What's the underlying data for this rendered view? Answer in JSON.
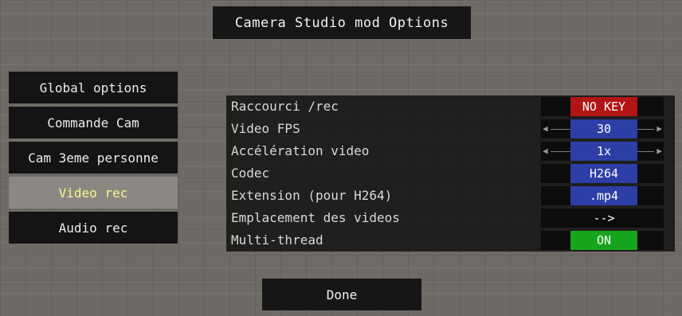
{
  "title": "Camera Studio mod Options",
  "sidebar": {
    "items": [
      {
        "label": "Global options"
      },
      {
        "label": "Commande Cam"
      },
      {
        "label": "Cam 3eme personne"
      },
      {
        "label": "Video rec",
        "active": true
      },
      {
        "label": "Audio rec"
      }
    ]
  },
  "options": [
    {
      "label": "Raccourci  /rec",
      "value": "NO KEY",
      "style": "red"
    },
    {
      "label": "Video FPS",
      "value": "30",
      "style": "blue",
      "slider": true
    },
    {
      "label": "Accélération video",
      "value": "1x",
      "style": "blue",
      "slider": true
    },
    {
      "label": "Codec",
      "value": "H264",
      "style": "blue"
    },
    {
      "label": "Extension (pour H264)",
      "value": ".mp4",
      "style": "blue"
    },
    {
      "label": "Emplacement des videos",
      "value": "-->",
      "style": "plain"
    },
    {
      "label": "Multi-thread",
      "value": "ON",
      "style": "green"
    }
  ],
  "footer": {
    "done_label": "Done"
  },
  "icons": {
    "left": "left-arrow-icon",
    "right": "right-arrow-icon"
  },
  "colors": {
    "active_text": "#f6f48a",
    "red": "#b21515",
    "blue": "#2d3ea6",
    "green": "#16a51c"
  }
}
